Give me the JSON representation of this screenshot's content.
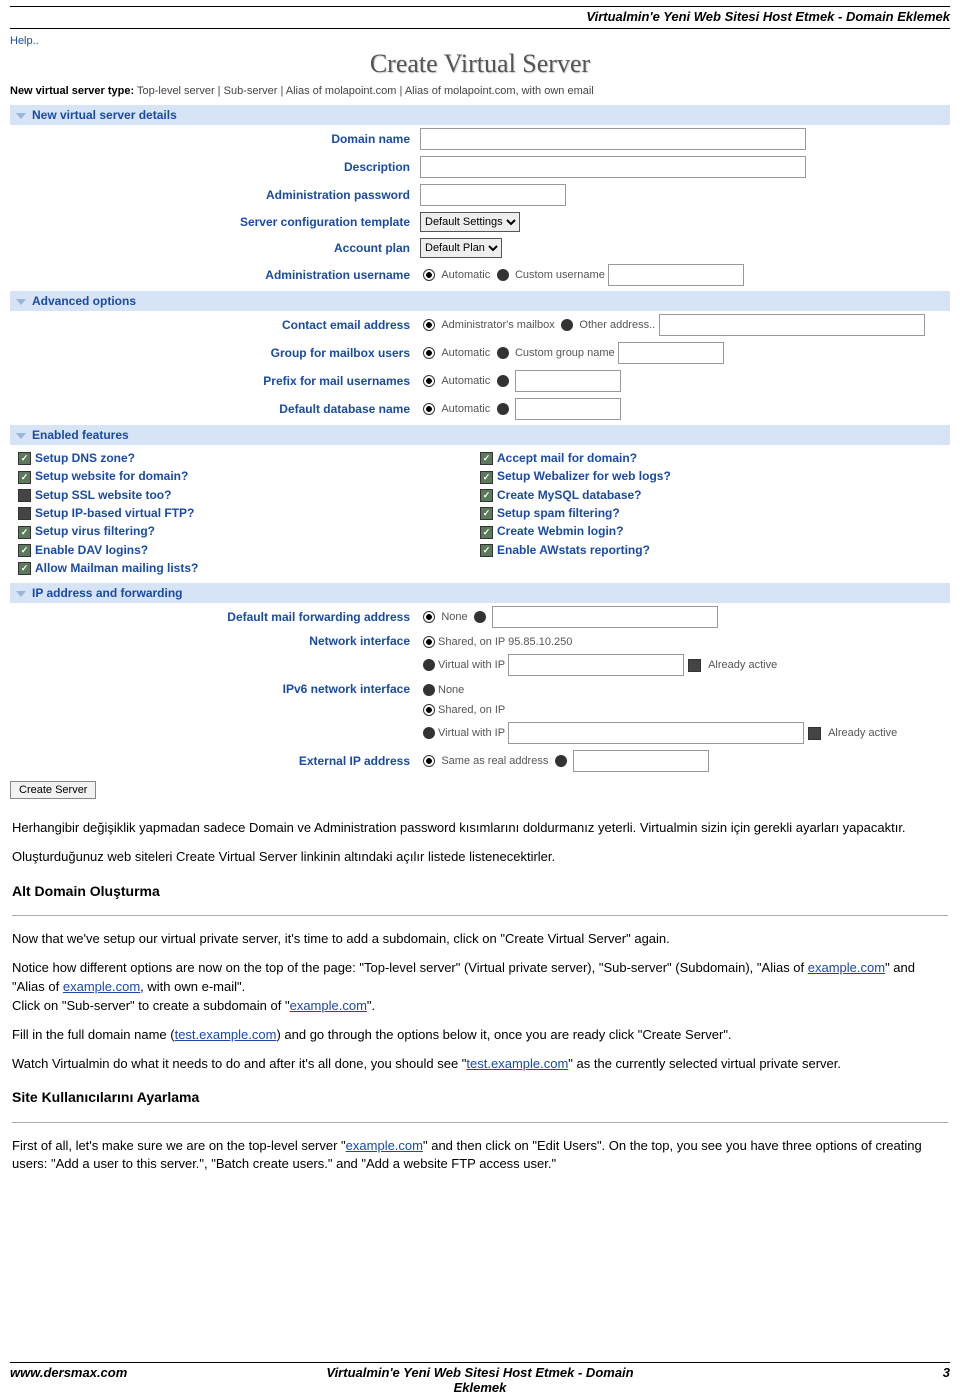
{
  "doc_header": "Virtualmin'e Yeni Web Sitesi Host Etmek - Domain Eklemek",
  "help_link": "Help..",
  "page_title": "Create Virtual Server",
  "server_type_row": {
    "label": "New virtual server type:",
    "opts": [
      "Top-level server",
      "Sub-server",
      "Alias of molapoint.com",
      "Alias of molapoint.com, with own email"
    ]
  },
  "sections": {
    "details": "New virtual server details",
    "advanced": "Advanced options",
    "features": "Enabled features",
    "ip": "IP address and forwarding"
  },
  "details": {
    "domain": "Domain name",
    "desc": "Description",
    "adminpw": "Administration password",
    "tmpl": "Server configuration template",
    "tmpl_val": "Default Settings",
    "plan": "Account plan",
    "plan_val": "Default Plan",
    "adminuser": "Administration username",
    "auto": "Automatic",
    "custom": "Custom username"
  },
  "advanced": {
    "contact": "Contact email address",
    "contact_a": "Administrator's mailbox",
    "contact_b": "Other address..",
    "group": "Group for mailbox users",
    "group_a": "Automatic",
    "group_b": "Custom group name",
    "prefix": "Prefix for mail usernames",
    "prefix_a": "Automatic",
    "dbname": "Default database name",
    "dbname_a": "Automatic"
  },
  "features_left": [
    "Setup DNS zone?",
    "Setup website for domain?",
    "Setup SSL website too?",
    "Setup IP-based virtual FTP?",
    "Setup virus filtering?",
    "Enable DAV logins?",
    "Allow Mailman mailing lists?"
  ],
  "features_right": [
    "Accept mail for domain?",
    "Setup Webalizer for web logs?",
    "Create MySQL database?",
    "Setup spam filtering?",
    "Create Webmin login?",
    "Enable AWstats reporting?"
  ],
  "ip": {
    "mailfwd": "Default mail forwarding address",
    "mailfwd_a": "None",
    "netif": "Network interface",
    "netif_a": "Shared, on IP 95.85.10.250",
    "netif_b": "Virtual with IP",
    "netif_c": "Already active",
    "ipv6": "IPv6 network interface",
    "ipv6_a": "None",
    "ipv6_b": "Shared, on IP",
    "ipv6_c": "Virtual with IP",
    "ipv6_d": "Already active",
    "extip": "External IP address",
    "extip_a": "Same as real address"
  },
  "create_btn": "Create Server",
  "article": {
    "p1": "Herhangibir değişiklik yapmadan sadece Domain ve Administration password kısımlarını doldurmanız yeterli. Virtualmin sizin için gerekli ayarları yapacaktır.",
    "p2": "Oluşturduğunuz web siteleri Create Virtual Server linkinin altındaki açılır listede listenecektirler.",
    "h1": "Alt Domain Oluşturma",
    "p3": "Now that we've setup our virtual private server, it's time to add a subdomain, click on \"Create Virtual Server\" again.",
    "p4a": "Notice how different options are now on the top of the page: \"Top-level server\" (Virtual private server), \"Sub-server\" (Subdomain), \"Alias of ",
    "p4link1": "example.com",
    "p4b": "\" and \"Alias of ",
    "p4link2": "example.com",
    "p4c": ", with own e-mail\".",
    "p4d": "Click on \"Sub-server\" to create a subdomain of \"",
    "p4link3": "example.com",
    "p4e": "\".",
    "p5a": "Fill in the full domain name (",
    "p5link": "test.example.com",
    "p5b": ") and go through the options below it, once you are ready click \"Create Server\".",
    "p6a": "Watch Virtualmin do what it needs to do and after it's all done, you should see \"",
    "p6link": "test.example.com",
    "p6b": "\" as the currently selected virtual private server.",
    "h2": "Site Kullanıcılarını Ayarlama",
    "p7a": "First of all, let's make sure we are on the top-level server \"",
    "p7link": "example.com",
    "p7b": "\" and then click on \"Edit Users\". On the top, you see you have three options of creating users: \"Add a user to this server.\", \"Batch create users.\" and \"Add a website FTP access user.\""
  },
  "footer": {
    "left": "www.dersmax.com",
    "center": "Virtualmin'e Yeni Web Sitesi Host Etmek - Domain Eklemek",
    "right": "3"
  }
}
